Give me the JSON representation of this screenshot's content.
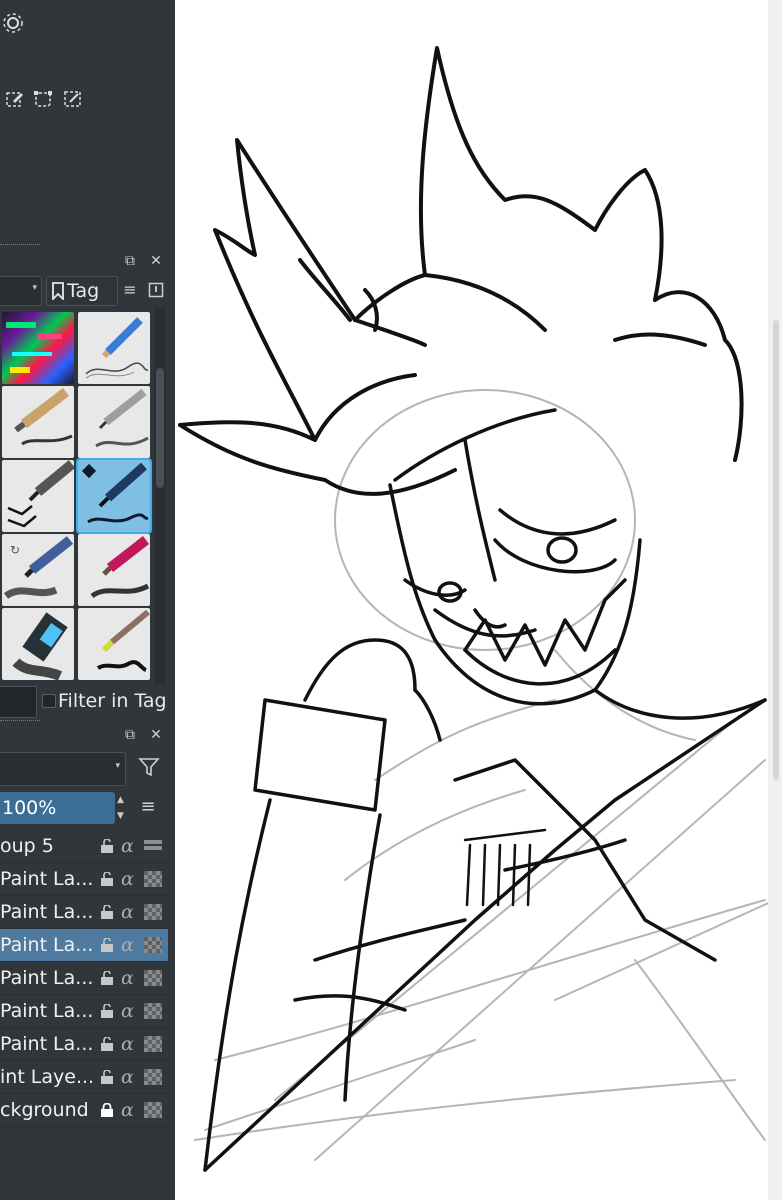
{
  "brush_presets": {
    "tag_label": "Tag",
    "filter_in_tag_label": "Filter in Tag"
  },
  "layers_panel": {
    "opacity_value": "100%",
    "layers": [
      {
        "name": "oup 5",
        "type": "group",
        "locked": false,
        "active": false
      },
      {
        "name": "Paint La...",
        "type": "paint",
        "locked": false,
        "active": false
      },
      {
        "name": "Paint La...",
        "type": "paint",
        "locked": false,
        "active": false
      },
      {
        "name": "Paint La...",
        "type": "paint",
        "locked": false,
        "active": true
      },
      {
        "name": "Paint La...",
        "type": "paint",
        "locked": false,
        "active": false
      },
      {
        "name": "Paint La...",
        "type": "paint",
        "locked": false,
        "active": false
      },
      {
        "name": "Paint La...",
        "type": "paint",
        "locked": false,
        "active": false
      },
      {
        "name": "int Laye...",
        "type": "paint",
        "locked": false,
        "active": false
      },
      {
        "name": "ckground",
        "type": "background",
        "locked": true,
        "active": false
      }
    ]
  },
  "colors": {
    "panel_bg": "#31363b",
    "selection_blue": "#4f7aa0",
    "opacity_fill": "#3b6e96",
    "accent": "#3daee9"
  }
}
